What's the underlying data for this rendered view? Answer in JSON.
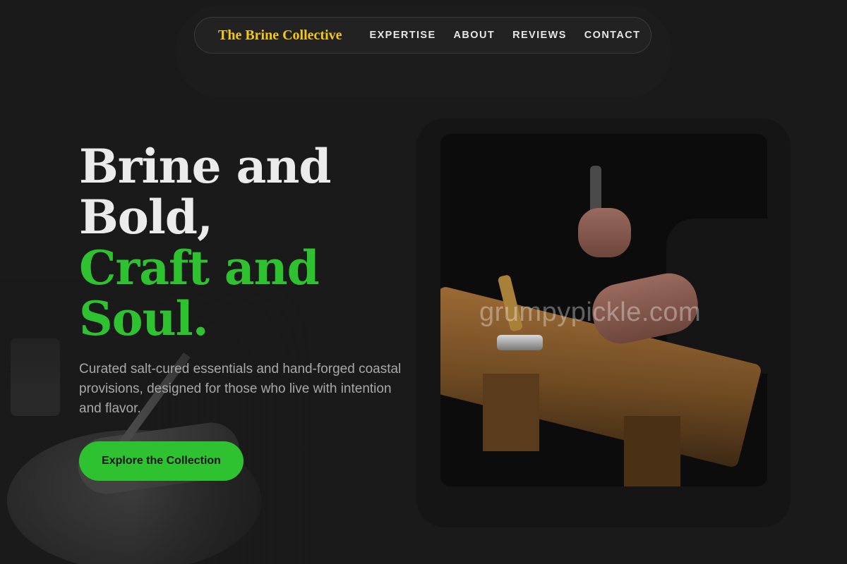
{
  "nav": {
    "brand": "The Brine Collective",
    "links": [
      "EXPERTISE",
      "ABOUT",
      "REVIEWS",
      "CONTACT"
    ]
  },
  "hero": {
    "title_lines": [
      "Brine and",
      "Bold,"
    ],
    "accent_lines": [
      "Craft and",
      "Soul."
    ],
    "subtitle": "Curated salt-cured essentials and hand-forged coastal provisions, designed for those who live with intention and flavor.",
    "cta_label": "Explore the Collection"
  },
  "image": {
    "watermark": "grumpypickle.com",
    "description_icon": "craftsman-hammering-workbench-photo"
  },
  "colors": {
    "background": "#1a1a1a",
    "brand": "#f2c811",
    "accent": "#2fc230"
  }
}
